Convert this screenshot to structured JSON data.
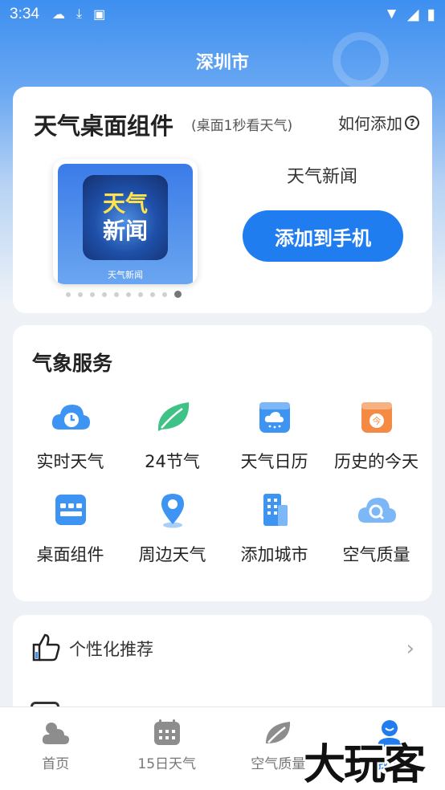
{
  "status_bar": {
    "time": "3:34"
  },
  "header": {
    "city": "深圳市"
  },
  "widget_card": {
    "title": "天气桌面组件",
    "subtitle": "(桌面1秒看天气)",
    "how_to_add": "如何添加",
    "preview_line1": "天气",
    "preview_line2": "新闻",
    "preview_caption": "天气新闻",
    "widget_name": "天气新闻",
    "add_button": "添加到手机",
    "page_count": 10,
    "active_page": 10
  },
  "services": {
    "title": "气象服务",
    "items": [
      {
        "label": "实时天气",
        "icon": "cloud-clock-icon"
      },
      {
        "label": "24节气",
        "icon": "leaf-icon"
      },
      {
        "label": "天气日历",
        "icon": "calendar-cloud-icon"
      },
      {
        "label": "历史的今天",
        "icon": "calendar-today-icon"
      },
      {
        "label": "桌面组件",
        "icon": "widget-icon"
      },
      {
        "label": "周边天气",
        "icon": "location-pin-icon"
      },
      {
        "label": "添加城市",
        "icon": "building-icon"
      },
      {
        "label": "空气质量",
        "icon": "cloud-search-icon"
      }
    ]
  },
  "recommend": {
    "label": "个性化推荐"
  },
  "tabbar": {
    "tabs": [
      {
        "label": "首页",
        "icon": "weather-home-icon"
      },
      {
        "label": "15日天气",
        "icon": "calendar-icon"
      },
      {
        "label": "空气质量",
        "icon": "leaf-icon"
      },
      {
        "label": "我的",
        "icon": "user-icon"
      }
    ],
    "active_tab": "我的"
  },
  "watermark": "大玩客",
  "colors": {
    "accent": "#1f7df0",
    "sky_top": "#3d8ff0"
  }
}
